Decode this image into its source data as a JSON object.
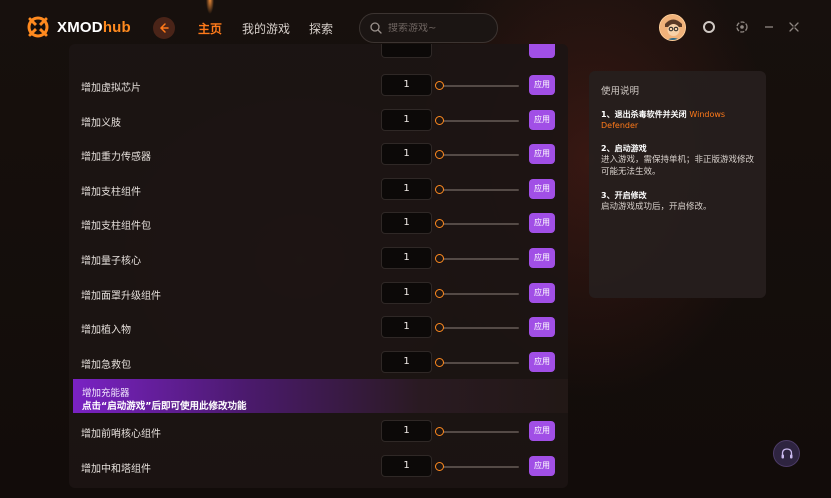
{
  "app": {
    "logo_main": "XMOD",
    "logo_hub": "hub"
  },
  "nav": {
    "tabs": [
      {
        "label": "主页",
        "active": true
      },
      {
        "label": "我的游戏",
        "active": false
      },
      {
        "label": "探索",
        "active": false
      }
    ]
  },
  "search": {
    "placeholder": "搜索游戏~"
  },
  "colors": {
    "accent": "#ff7a1a",
    "apply_button": "#a14fe6"
  },
  "mods": {
    "apply_label": "应用",
    "rows": [
      {
        "label": "增加虚拟芯片",
        "value": "1"
      },
      {
        "label": "增加义肢",
        "value": "1"
      },
      {
        "label": "增加重力传感器",
        "value": "1"
      },
      {
        "label": "增加支柱组件",
        "value": "1"
      },
      {
        "label": "增加支柱组件包",
        "value": "1"
      },
      {
        "label": "增加量子核心",
        "value": "1"
      },
      {
        "label": "增加面罩升级组件",
        "value": "1"
      },
      {
        "label": "增加植入物",
        "value": "1"
      },
      {
        "label": "增加急救包",
        "value": "1"
      }
    ],
    "locked_row": {
      "label": "增加充能器",
      "message": "点击“启动游戏”后即可使用此修改功能"
    },
    "rows_after": [
      {
        "label": "增加前哨核心组件",
        "value": "1"
      },
      {
        "label": "增加中和塔组件",
        "value": "1"
      }
    ]
  },
  "instructions": {
    "title": "使用说明",
    "step1_title": "1、退出杀毒软件并关闭",
    "step1_highlight": "Windows Defender",
    "step2_title": "2、启动游戏",
    "step2_text": "进入游戏，需保持单机；非正版游戏修改可能无法生效。",
    "step3_title": "3、开启修改",
    "step3_text": "启动游戏成功后，开启修改。"
  },
  "icons": {
    "logo": "xmod-logo-icon",
    "back": "back-arrow-icon",
    "search": "search-icon",
    "notification": "ring-icon",
    "settings": "settings-icon",
    "minimize": "minimize-icon",
    "fullscreen": "fullscreen-icon",
    "support": "headset-icon"
  }
}
